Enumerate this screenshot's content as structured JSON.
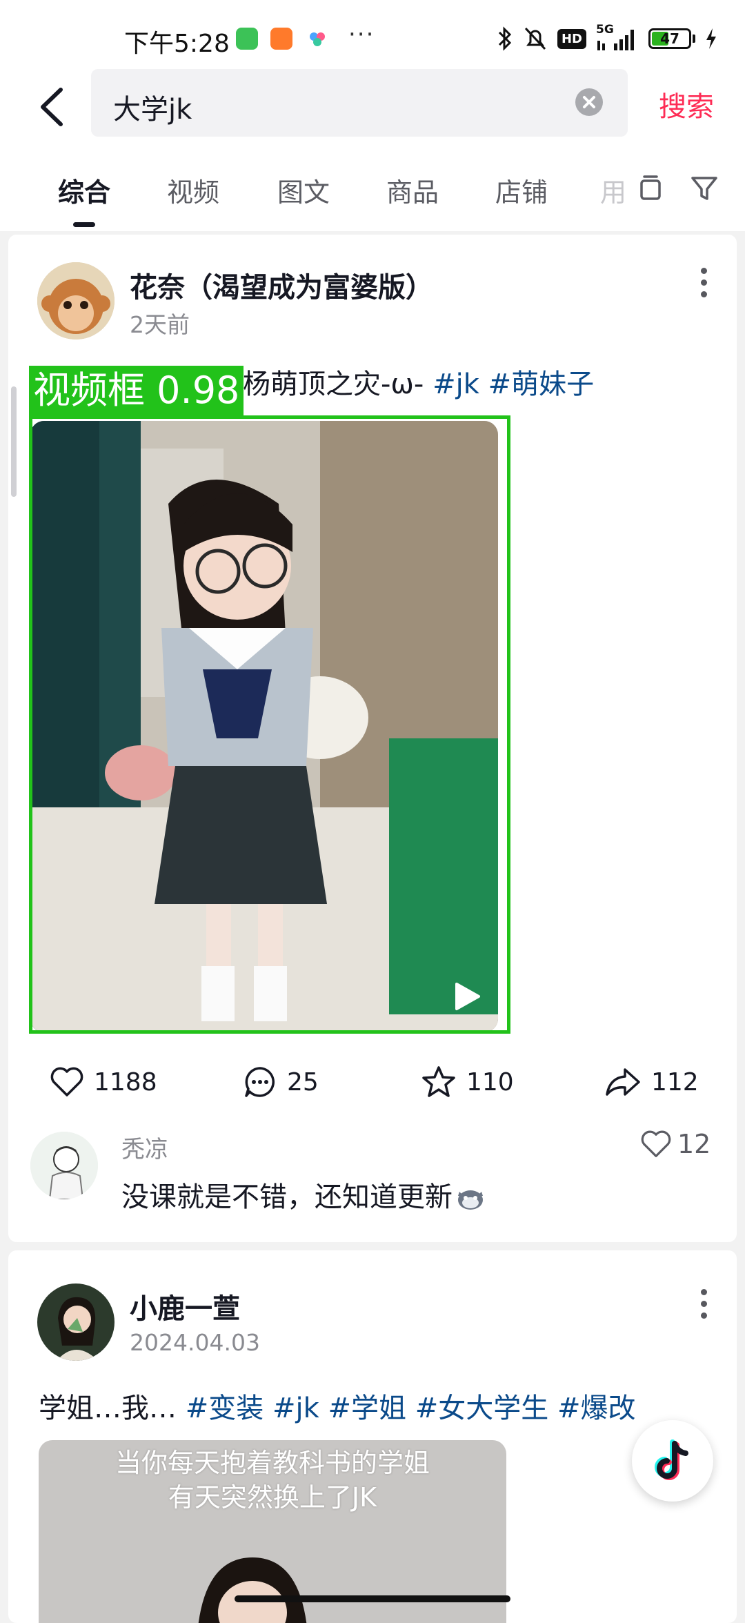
{
  "status_bar": {
    "time": "下午5:28",
    "network": "5G",
    "hd": "HD",
    "battery_level": "47",
    "battery_fraction": 0.47
  },
  "search": {
    "query": "大学jk",
    "search_button": "搜索"
  },
  "tabs": [
    {
      "label": "综合",
      "active": true
    },
    {
      "label": "视频",
      "active": false
    },
    {
      "label": "图文",
      "active": false
    },
    {
      "label": "商品",
      "active": false
    },
    {
      "label": "店铺",
      "active": false
    },
    {
      "label": "用",
      "active": false
    }
  ],
  "posts": [
    {
      "author": "花奈（渴望成为富婆版）",
      "time": "2天前",
      "caption_text": "杨萌顶之灾-ω-",
      "tags": [
        "#jk",
        "#萌妹子"
      ],
      "detection": {
        "label": "视频框",
        "score": "0.98"
      },
      "stats": {
        "likes": "1188",
        "comments": "25",
        "favorites": "110",
        "shares": "112"
      },
      "top_comment": {
        "user": "秃凉",
        "text": "没课就是不错，还知道更新",
        "likes": "12"
      }
    },
    {
      "author": "小鹿一萱",
      "time": "2024.04.03",
      "caption_text": "学姐…我…",
      "tags": [
        "#变装",
        "#jk",
        "#学姐",
        "#女大学生",
        "#爆改"
      ],
      "thumbnail_overlay": [
        "当你每天抱着教科书的学姐",
        "有天突然换上了JK"
      ]
    }
  ],
  "colors": {
    "accent": "#fe2c55",
    "hashtag": "#0b4a8a",
    "detection_box": "#22c21a"
  }
}
